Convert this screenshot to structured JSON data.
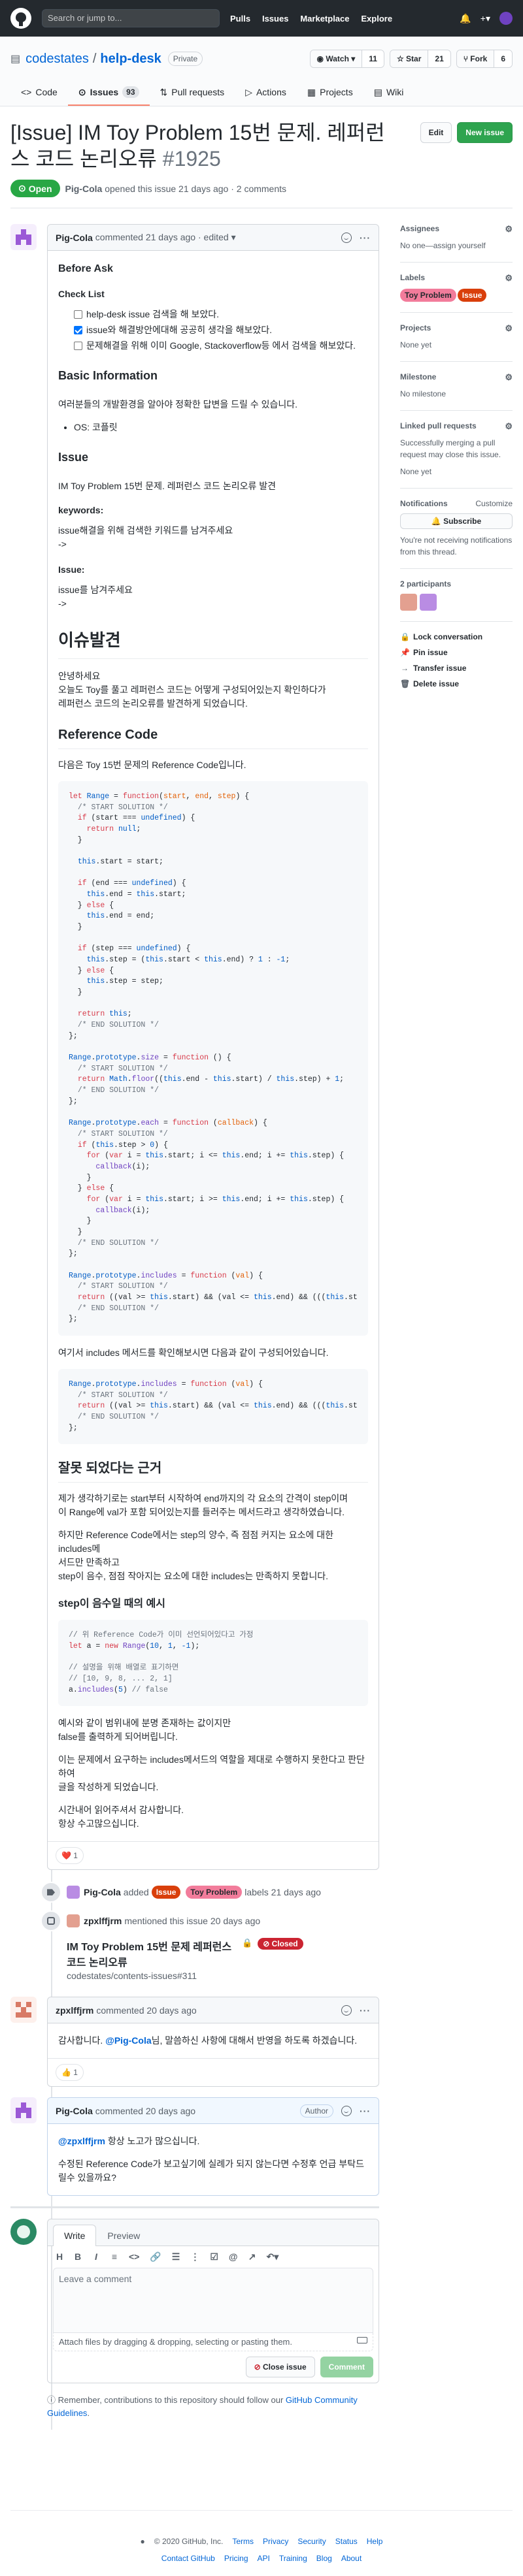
{
  "header": {
    "search_placeholder": "Search or jump to...",
    "nav": [
      "Pulls",
      "Issues",
      "Marketplace",
      "Explore"
    ],
    "bell": "🔔",
    "plus": "+▾"
  },
  "repo": {
    "owner": "codestates",
    "separator": "/",
    "name": "help-desk",
    "visibility": "Private",
    "watch_label": "Watch ▾",
    "watch_count": "11",
    "star_label": "Star",
    "star_count": "21",
    "fork_label": "Fork",
    "fork_count": "6"
  },
  "tabs": [
    {
      "label": "Code",
      "icon": "<>"
    },
    {
      "label": "Issues",
      "icon": "⊙",
      "count": "93"
    },
    {
      "label": "Pull requests",
      "icon": "⇅"
    },
    {
      "label": "Actions",
      "icon": "▷"
    },
    {
      "label": "Projects",
      "icon": "▦"
    },
    {
      "label": "Wiki",
      "icon": "▤"
    }
  ],
  "issue": {
    "title": "[Issue] IM Toy Problem 15번 문제. 레퍼런스 코드 논리오류",
    "number": "#1925",
    "edit_label": "Edit",
    "new_issue_label": "New issue",
    "state": "Open",
    "author": "Pig-Cola",
    "opened_text": "opened this issue 21 days ago · 2 comments"
  },
  "main_comment": {
    "author": "Pig-Cola",
    "meta": "commented 21 days ago · edited ▾",
    "before_ask": "Before Ask",
    "check_list": "Check List",
    "checks": [
      {
        "text": "help-desk issue 검색을 해 보았다.",
        "checked": false
      },
      {
        "text": "issue와 해결방안에대해 공공히 생각을 해보았다.",
        "checked": true
      },
      {
        "text": "문제해결을 위해 이미 Google, Stackoverflow등 에서 검색을 해보았다.",
        "checked": false
      }
    ],
    "basic_info": "Basic Information",
    "basic_info_desc": "여러분들의 개발환경을 알아야 정확한 답변을 드릴 수 있습니다.",
    "os": "OS: 코플릿",
    "issue_h": "Issue",
    "issue_desc": "IM Toy Problem 15번 문제. 레퍼런스 코드 논리오류 발견",
    "keywords_h": "keywords:",
    "keywords_desc": "issue해결을 위해 검색한 키워드를 남겨주세요",
    "arrow1": "->",
    "issue2_h": "Issue:",
    "issue2_desc": "issue를 남겨주세요",
    "arrow2": "->",
    "found_h": "이슈발견",
    "found_p1": "안녕하세요",
    "found_p2": "오늘도 Toy를 풀고 레퍼런스 코드는 어떻게 구성되어있는지 확인하다가",
    "found_p3": "레퍼런스 코드의 논리오류를 발견하게 되었습니다.",
    "ref_h": "Reference Code",
    "ref_intro": "다음은 Toy 15번 문제의 Reference Code입니다.",
    "includes_intro": "여기서 includes 메서드를 확인해보시면 다음과 같이 구성되어있습니다.",
    "wrong_h": "잘못 되었다는 근거",
    "wrong_p1": "제가 생각하기로는 start부터 시작하여 end까지의 각 요소의 간격이 step이며",
    "wrong_p2": "이 Range에 val가 포함 되어있는지를 들러주는 메서드라고 생각하였습니다.",
    "wrong_p3": "하지만 Reference Code에서는 step의 양수, 즉 점점 커지는 요소에 대한 includes메",
    "wrong_p4": "서드만 만족하고",
    "wrong_p5": "step이 음수, 점점 작아지는 요소에 대한 includes는 만족하지 못합니다.",
    "neg_h": "step이 음수일 때의 예시",
    "example_p1": "예시와 같이 범위내에 분명 존재하는 값이지만",
    "example_p2": "false를 출력하게 되어버립니다.",
    "concl_p1": "이는 문제에서 요구하는 includes메서드의 역할을 제대로 수행하지 못한다고 판단하여",
    "concl_p2": "글을 작성하게 되었습니다.",
    "thanks_p1": "시간내어 읽어주셔서 감사합니다.",
    "thanks_p2": "항상 수고많으십니다.",
    "reaction": "❤️ 1"
  },
  "events": {
    "labeled_user": "Pig-Cola",
    "labeled_added": "added",
    "label_issue": "Issue",
    "label_toy": "Toy Problem",
    "labeled_time": "labels 21 days ago",
    "mention_user": "zpxlffjrm",
    "mention_text": "mentioned this issue 20 days ago",
    "ref_title": "IM Toy Problem 15번 문제 레퍼런스 코드 논리오류",
    "ref_lock": "🔒",
    "ref_state": "⊘ Closed",
    "ref_repo": "codestates/contents-issues#311"
  },
  "comment2": {
    "author": "zpxlffjrm",
    "meta": "commented 20 days ago",
    "body_pre": "감사합니다.",
    "body_mention": "@Pig-Cola",
    "body_post": "님, 말씀하신 사항에 대해서 반영을 하도록 하겠습니다.",
    "reaction": "👍 1"
  },
  "comment3": {
    "author": "Pig-Cola",
    "meta": "commented 20 days ago",
    "badge": "Author",
    "body_mention": "@zpxlffjrm",
    "body_p1_rest": "항상 노고가 많으십니다.",
    "body_p2": "수정된 Reference Code가 보고싶기에 실례가 되지 않는다면 수정후 언급 부탁드릴수 있을까요?"
  },
  "editor": {
    "tab_write": "Write",
    "tab_preview": "Preview",
    "tools": [
      "H",
      "B",
      "I",
      "≡",
      "<>",
      "🔗",
      "☰",
      "⋮",
      "☑",
      "@",
      "↗",
      "↶▾"
    ],
    "placeholder": "Leave a comment",
    "attach": "Attach files by dragging & dropping, selecting or pasting them.",
    "close_label": "Close issue",
    "comment_label": "Comment",
    "remember_pre": "Remember, contributions to this repository should follow our",
    "remember_link": "GitHub Community Guidelines",
    "remember_post": "."
  },
  "sidebar": {
    "assignees_h": "Assignees",
    "assignees_v": "No one—assign yourself",
    "labels_h": "Labels",
    "projects_h": "Projects",
    "projects_v": "None yet",
    "milestone_h": "Milestone",
    "milestone_v": "No milestone",
    "linked_h": "Linked pull requests",
    "linked_v": "Successfully merging a pull request may close this issue.",
    "linked_none": "None yet",
    "notif_h": "Notifications",
    "notif_customize": "Customize",
    "subscribe": "🔔 Subscribe",
    "notif_v": "You're not receiving notifications from this thread.",
    "participants_h": "2 participants",
    "lock": "Lock conversation",
    "pin": "Pin issue",
    "transfer": "Transfer issue",
    "delete": "Delete issue"
  },
  "footer": {
    "copyright": "© 2020 GitHub, Inc.",
    "row1": [
      "Terms",
      "Privacy",
      "Security",
      "Status",
      "Help"
    ],
    "row2": [
      "Contact GitHub",
      "Pricing",
      "API",
      "Training",
      "Blog",
      "About"
    ]
  },
  "colors": {
    "label_issue": "#d93f0b",
    "label_toy": "#f27c9b",
    "open": "#28a745",
    "closed": "#cb2431"
  }
}
